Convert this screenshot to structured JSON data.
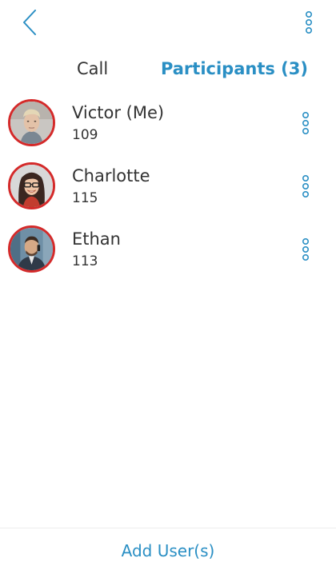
{
  "header": {
    "back_icon": "chevron-left-icon",
    "more_icon": "vertical-dots-icon"
  },
  "tabs": [
    {
      "label": "Call",
      "active": false
    },
    {
      "label": "Participants (3)",
      "active": true
    }
  ],
  "participants": [
    {
      "name": "Victor (Me)",
      "extension": "109",
      "avatar": "avatar-victor"
    },
    {
      "name": "Charlotte",
      "extension": "115",
      "avatar": "avatar-charlotte"
    },
    {
      "name": "Ethan",
      "extension": "113",
      "avatar": "avatar-ethan"
    }
  ],
  "footer": {
    "add_user_label": "Add User(s)"
  },
  "colors": {
    "accent": "#2a8fc4",
    "avatar_ring": "#d42a2a",
    "text": "#333333",
    "background": "#ffffff"
  }
}
